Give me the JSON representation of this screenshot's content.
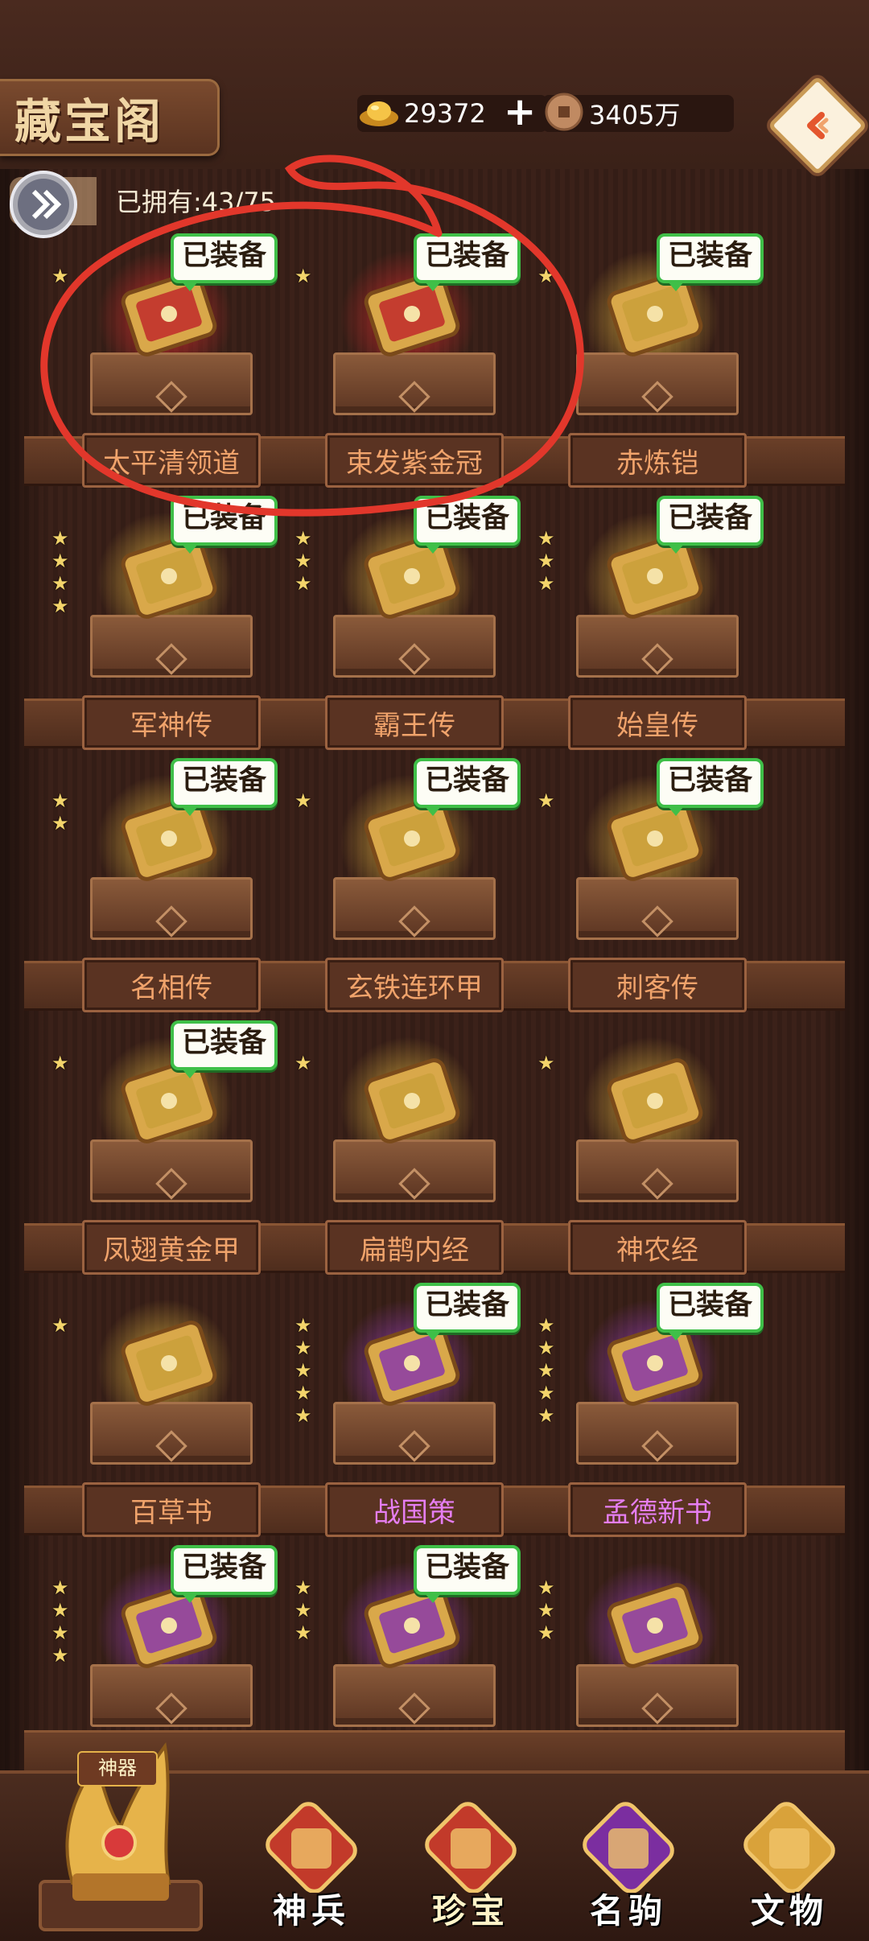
{
  "header": {
    "title": "藏宝阁",
    "gold": "29372",
    "copper": "3405万",
    "back_icon": "back-arrow-icon"
  },
  "owned": {
    "text": "已拥有:43/75"
  },
  "badge_label": "已装备",
  "items": [
    {
      "name": "太平清领道",
      "stars": 1,
      "equipped": true,
      "color": "#c02a2a",
      "plate": "normal"
    },
    {
      "name": "束发紫金冠",
      "stars": 1,
      "equipped": true,
      "color": "#c02a2a",
      "plate": "normal"
    },
    {
      "name": "赤炼铠",
      "stars": 1,
      "equipped": true,
      "color": "#c9a03a",
      "plate": "normal"
    },
    {
      "name": "军神传",
      "stars": 4,
      "equipped": true,
      "color": "#c9a03a",
      "plate": "normal"
    },
    {
      "name": "霸王传",
      "stars": 3,
      "equipped": true,
      "color": "#c9a03a",
      "plate": "normal"
    },
    {
      "name": "始皇传",
      "stars": 3,
      "equipped": true,
      "color": "#c9a03a",
      "plate": "normal"
    },
    {
      "name": "名相传",
      "stars": 2,
      "equipped": true,
      "color": "#c9a03a",
      "plate": "normal"
    },
    {
      "name": "玄铁连环甲",
      "stars": 1,
      "equipped": true,
      "color": "#c9a03a",
      "plate": "normal"
    },
    {
      "name": "刺客传",
      "stars": 1,
      "equipped": true,
      "color": "#c9a03a",
      "plate": "normal"
    },
    {
      "name": "凤翅黄金甲",
      "stars": 1,
      "equipped": true,
      "color": "#c9a03a",
      "plate": "normal"
    },
    {
      "name": "扁鹊内经",
      "stars": 1,
      "equipped": false,
      "color": "#c9a03a",
      "plate": "normal"
    },
    {
      "name": "神农经",
      "stars": 1,
      "equipped": false,
      "color": "#c9a03a",
      "plate": "normal"
    },
    {
      "name": "百草书",
      "stars": 1,
      "equipped": false,
      "color": "#c9a03a",
      "plate": "normal"
    },
    {
      "name": "战国策",
      "stars": 5,
      "equipped": true,
      "color": "#8a3aa8",
      "plate": "purple"
    },
    {
      "name": "孟德新书",
      "stars": 5,
      "equipped": true,
      "color": "#8a3aa8",
      "plate": "purple"
    },
    {
      "name": "",
      "stars": 4,
      "equipped": true,
      "color": "#8a3aa8",
      "plate": "none"
    },
    {
      "name": "",
      "stars": 3,
      "equipped": true,
      "color": "#8a3aa8",
      "plate": "none"
    },
    {
      "name": "",
      "stars": 3,
      "equipped": false,
      "color": "#8a3aa8",
      "plate": "none"
    }
  ],
  "tabs": [
    {
      "label": "神兵",
      "icon": "weapon-icon",
      "active": false
    },
    {
      "label": "珍宝",
      "icon": "treasure-gift-icon",
      "active": true
    },
    {
      "label": "名驹",
      "icon": "horse-icon",
      "active": false
    },
    {
      "label": "文物",
      "icon": "relic-icon",
      "active": false
    }
  ],
  "shenqi_label": "神器",
  "colors": {
    "badge_border": "#3fbf48",
    "name_orange": "#f0a36b",
    "name_purple": "#e57ef1",
    "star": "#f3d46b"
  }
}
